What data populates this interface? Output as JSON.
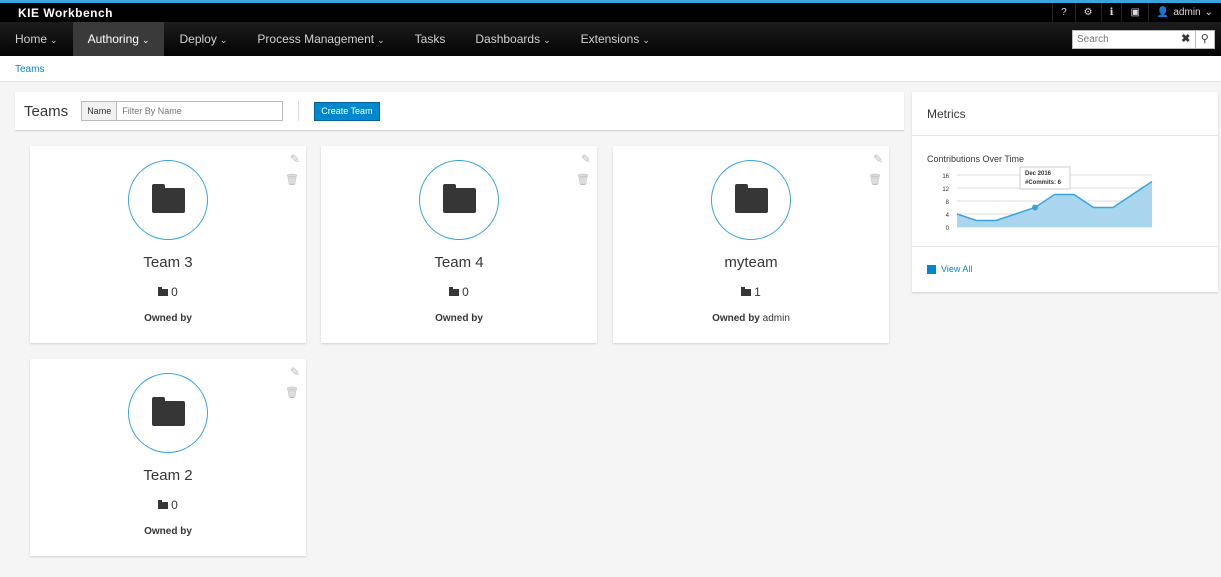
{
  "app": {
    "title": "KIE Workbench"
  },
  "utility": {
    "help": "?",
    "settings": "⚙",
    "info": "ℹ",
    "camera": "📷",
    "user": "admin"
  },
  "nav": [
    {
      "label": "Home",
      "dropdown": true
    },
    {
      "label": "Authoring",
      "dropdown": true,
      "active": true
    },
    {
      "label": "Deploy",
      "dropdown": true
    },
    {
      "label": "Process Management",
      "dropdown": true
    },
    {
      "label": "Tasks",
      "dropdown": false
    },
    {
      "label": "Dashboards",
      "dropdown": true
    },
    {
      "label": "Extensions",
      "dropdown": true
    }
  ],
  "search": {
    "placeholder": "Search"
  },
  "breadcrumb": "Teams",
  "teams": {
    "title": "Teams",
    "filter_label": "Name",
    "filter_placeholder": "Filter By Name",
    "create": "Create Team"
  },
  "cards": [
    {
      "name": "Team 3",
      "count": "0",
      "owned_by": "Owned by",
      "owner": ""
    },
    {
      "name": "Team 4",
      "count": "0",
      "owned_by": "Owned by",
      "owner": ""
    },
    {
      "name": "myteam",
      "count": "1",
      "owned_by": "Owned by",
      "owner": "admin"
    },
    {
      "name": "Team 2",
      "count": "0",
      "owned_by": "Owned by",
      "owner": ""
    }
  ],
  "metrics": {
    "title": "Metrics",
    "view_all": "View All"
  },
  "chart_data": {
    "type": "area",
    "title": "Contributions Over Time",
    "yticks": [
      0,
      4,
      8,
      12,
      16
    ],
    "ylim": [
      0,
      16
    ],
    "values": [
      4,
      2,
      2,
      4,
      6,
      10,
      10,
      6,
      6,
      10,
      14
    ],
    "grid": true,
    "color": "#39a5dc",
    "tooltip": {
      "title": "Dec 2016",
      "label": "#Commits: 6"
    }
  }
}
